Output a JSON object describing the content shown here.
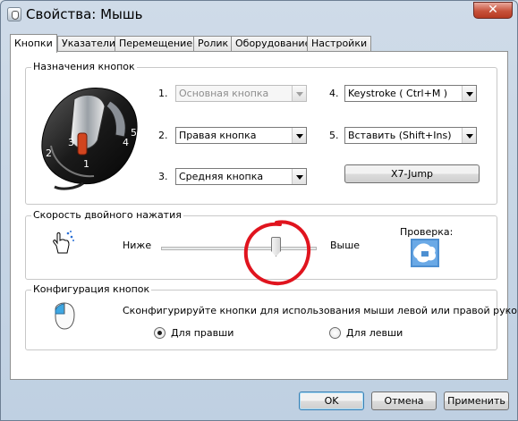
{
  "window": {
    "title": "Свойства: Мышь",
    "close_label": "✕",
    "close_color": "#c7523b"
  },
  "tabs": [
    {
      "label": "Кнопки",
      "active": true
    },
    {
      "label": "Указатели",
      "active": false
    },
    {
      "label": "Перемещение",
      "active": false
    },
    {
      "label": "Ролик",
      "active": false
    },
    {
      "label": "Оборудование",
      "active": false
    },
    {
      "label": "Настройки",
      "active": false
    }
  ],
  "button_assignments": {
    "title": "Назначения кнопок",
    "mouse_image_numbers": [
      "1",
      "2",
      "3",
      "4",
      "5"
    ],
    "items": [
      {
        "number": "1.",
        "value": "Основная кнопка",
        "disabled": true
      },
      {
        "number": "2.",
        "value": "Правая кнопка",
        "disabled": false
      },
      {
        "number": "3.",
        "value": "Средняя кнопка",
        "disabled": false
      },
      {
        "number": "4.",
        "value": "Keystroke ( Ctrl+M )",
        "disabled": false
      },
      {
        "number": "5.",
        "value": "Вставить (Shift+Ins)",
        "disabled": false
      }
    ],
    "x7_button": "X7-Jump"
  },
  "double_click": {
    "title": "Скорость двойного нажатия",
    "slower_label": "Ниже",
    "faster_label": "Выше",
    "test_label": "Проверка:",
    "speed_fraction": 0.72,
    "annotation_color": "#e0141e"
  },
  "button_config": {
    "title": "Конфигурация кнопок",
    "description": "Сконфигурируйте кнопки для использования мыши левой или правой рукой.",
    "right_handed_label": "Для правши",
    "left_handed_label": "Для левши",
    "selected": "right"
  },
  "footer": {
    "ok_label": "OK",
    "cancel_label": "Отмена",
    "apply_label": "Применить"
  }
}
